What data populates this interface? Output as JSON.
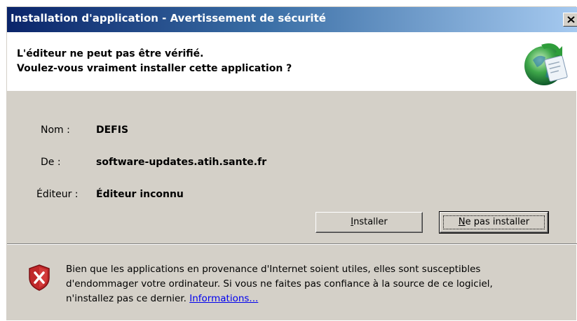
{
  "window": {
    "title": "Installation d'application - Avertissement de sécurité",
    "close_glyph": "X"
  },
  "header": {
    "line1": "L'éditeur ne peut pas être vérifié.",
    "line2": "Voulez-vous vraiment installer cette application ?",
    "icon": "globe-app-icon"
  },
  "details": [
    {
      "label": "Nom :",
      "value": "DEFIS"
    },
    {
      "label": "De :",
      "value": "software-updates.atih.sante.fr"
    },
    {
      "label": "Éditeur :",
      "value": "Éditeur inconnu"
    }
  ],
  "buttons": {
    "install_prefix": "",
    "install_accel": "I",
    "install_rest": "nstaller",
    "dont_install_prefix": "",
    "dont_install_accel": "N",
    "dont_install_rest": "e pas installer"
  },
  "warning": {
    "icon": "shield-x-icon",
    "line1": "Bien que les applications en provenance d'Internet soient utiles, elles sont susceptibles",
    "line2": "d'endommager votre ordinateur. Si vous ne faites pas confiance à la source de ce logiciel,",
    "line3_prefix": "n'installez pas ce dernier. ",
    "link": "Informations..."
  },
  "colors": {
    "title_gradient_start": "#0a246a",
    "title_gradient_end": "#a6caf0",
    "dialog_bg": "#d4d0c8",
    "link": "#0000ee"
  }
}
